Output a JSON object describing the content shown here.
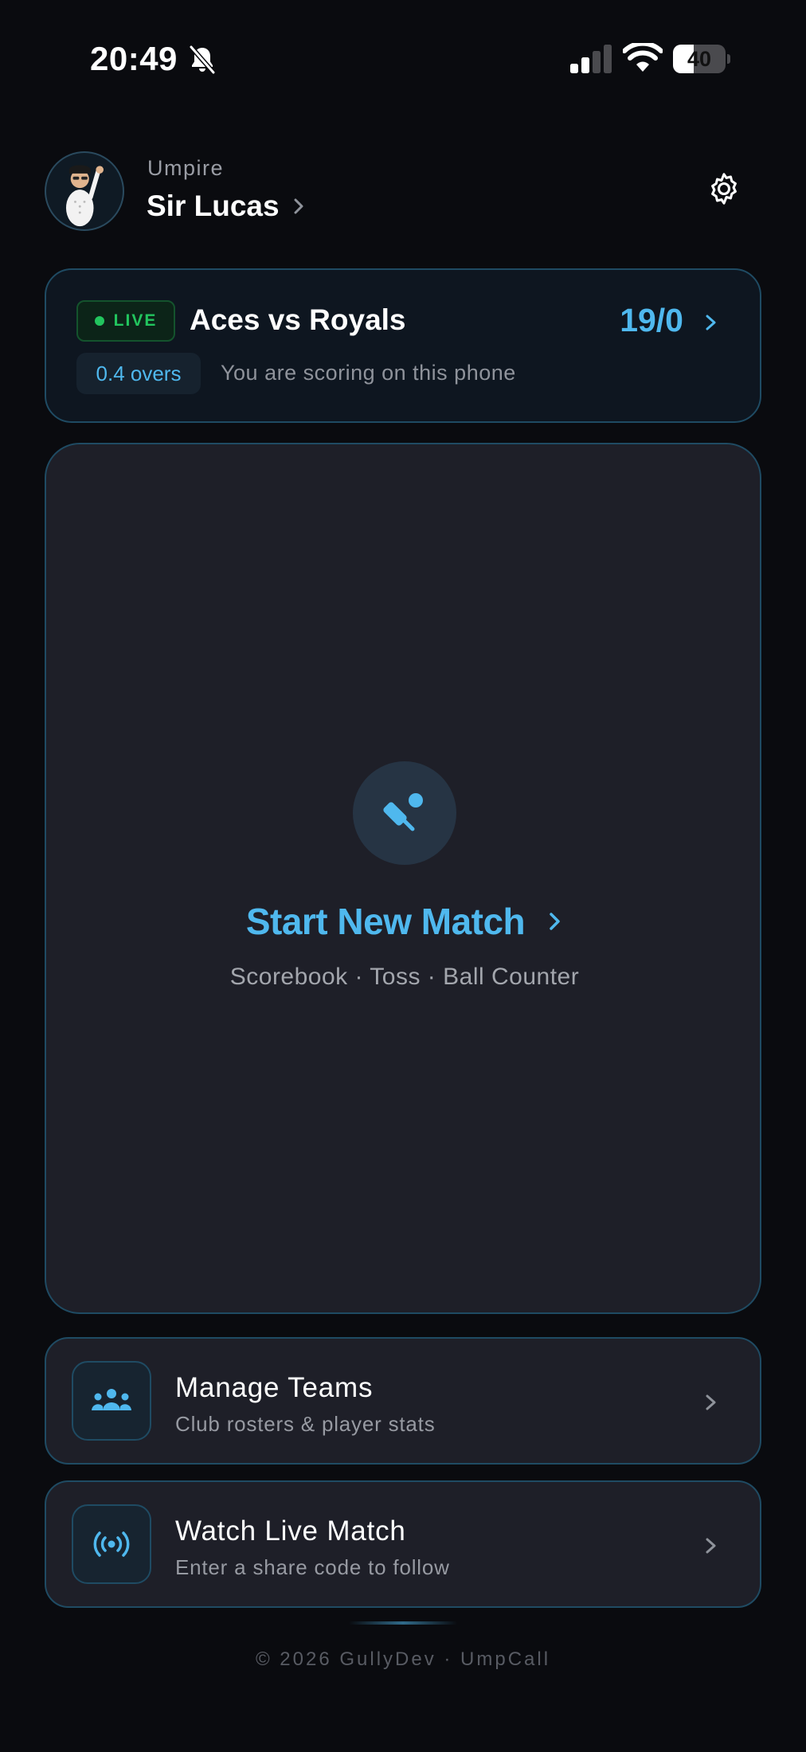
{
  "status_bar": {
    "time": "20:49",
    "battery_percent": "40",
    "battery_level": 0.4
  },
  "header": {
    "role": "Umpire",
    "name": "Sir Lucas"
  },
  "live_match": {
    "badge": "LIVE",
    "title": "Aces vs Royals",
    "score": "19/0",
    "overs": "0.4 overs",
    "note": "You are scoring on this phone"
  },
  "new_match": {
    "title": "Start New Match",
    "subtitle": "Scorebook · Toss · Ball Counter"
  },
  "menu": [
    {
      "title": "Manage Teams",
      "subtitle": "Club rosters & player stats",
      "icon": "team-icon"
    },
    {
      "title": "Watch Live Match",
      "subtitle": "Enter a share code to follow",
      "icon": "broadcast-icon"
    }
  ],
  "footer": "© 2026 GullyDev · UmpCall",
  "colors": {
    "accent": "#4fb8ee",
    "live_green": "#22c55e",
    "card_border": "#1f4b63",
    "background": "#0a0b0f"
  }
}
